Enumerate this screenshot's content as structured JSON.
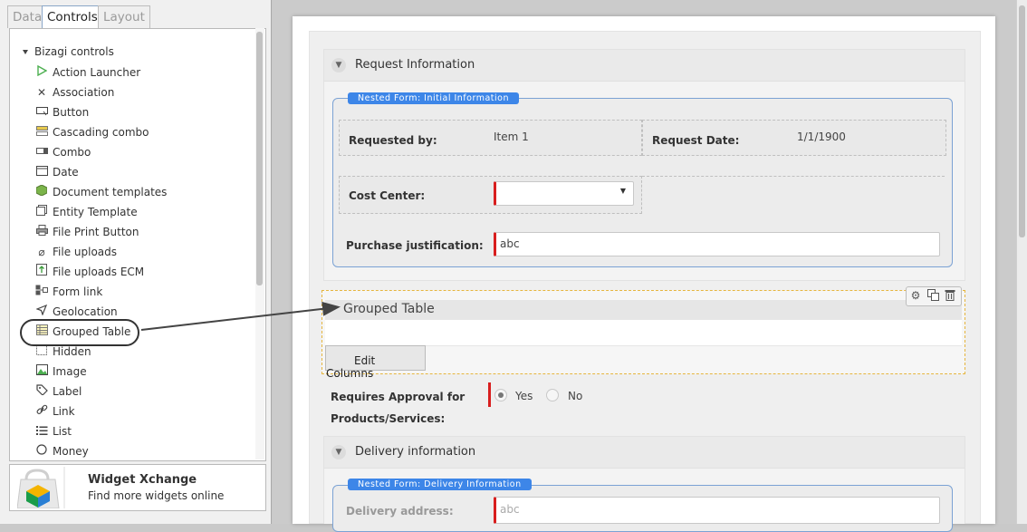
{
  "left_panel": {
    "tabs": [
      {
        "label": "Data"
      },
      {
        "label": "Controls"
      },
      {
        "label": "Layout"
      }
    ],
    "tree_root": "Bizagi controls",
    "items": [
      {
        "label": "Action Launcher",
        "icon": "play-icon"
      },
      {
        "label": "Association",
        "icon": "association-icon"
      },
      {
        "label": "Button",
        "icon": "button-icon"
      },
      {
        "label": "Cascading combo",
        "icon": "cascading-combo-icon"
      },
      {
        "label": "Combo",
        "icon": "combo-icon"
      },
      {
        "label": "Date",
        "icon": "calendar-icon"
      },
      {
        "label": "Document templates",
        "icon": "document-template-icon"
      },
      {
        "label": "Entity Template",
        "icon": "entity-template-icon"
      },
      {
        "label": "File Print Button",
        "icon": "printer-icon"
      },
      {
        "label": "File uploads",
        "icon": "paperclip-icon"
      },
      {
        "label": "File uploads ECM",
        "icon": "upload-icon"
      },
      {
        "label": "Form link",
        "icon": "form-link-icon"
      },
      {
        "label": "Geolocation",
        "icon": "location-arrow-icon"
      },
      {
        "label": "Grouped Table",
        "icon": "grouped-table-icon"
      },
      {
        "label": "Hidden",
        "icon": "hidden-icon"
      },
      {
        "label": "Image",
        "icon": "image-icon"
      },
      {
        "label": "Label",
        "icon": "tag-icon"
      },
      {
        "label": "Link",
        "icon": "link-icon"
      },
      {
        "label": "List",
        "icon": "list-icon"
      },
      {
        "label": "Money",
        "icon": "money-icon"
      }
    ],
    "widget_xchange": {
      "title": "Widget Xchange",
      "subtitle": "Find more widgets online"
    }
  },
  "form": {
    "group1": {
      "title": "Request Information",
      "nested_title": "Nested Form: Initial Information",
      "requested_by_label": "Requested by:",
      "requested_by_value": "Item 1",
      "request_date_label": "Request Date:",
      "request_date_value": "1/1/1900",
      "cost_center_label": "Cost Center:",
      "cost_center_value": "",
      "justification_label": "Purchase justification:",
      "justification_value": "abc"
    },
    "grouped_table": {
      "title": "Grouped Table",
      "edit_columns_label": "Edit Columns"
    },
    "approval": {
      "label_line1": "Requires Approval for",
      "label_line2": "Products/Services:",
      "yes_label": "Yes",
      "no_label": "No",
      "selected": "Yes"
    },
    "group2": {
      "title": "Delivery information",
      "nested_title": "Nested Form: Delivery Information",
      "delivery_address_label": "Delivery address:",
      "delivery_address_placeholder": "abc"
    }
  },
  "colors": {
    "accent_blue": "#3d86e8",
    "required_red": "#d81e1e",
    "selection_border": "#e6b53e"
  }
}
